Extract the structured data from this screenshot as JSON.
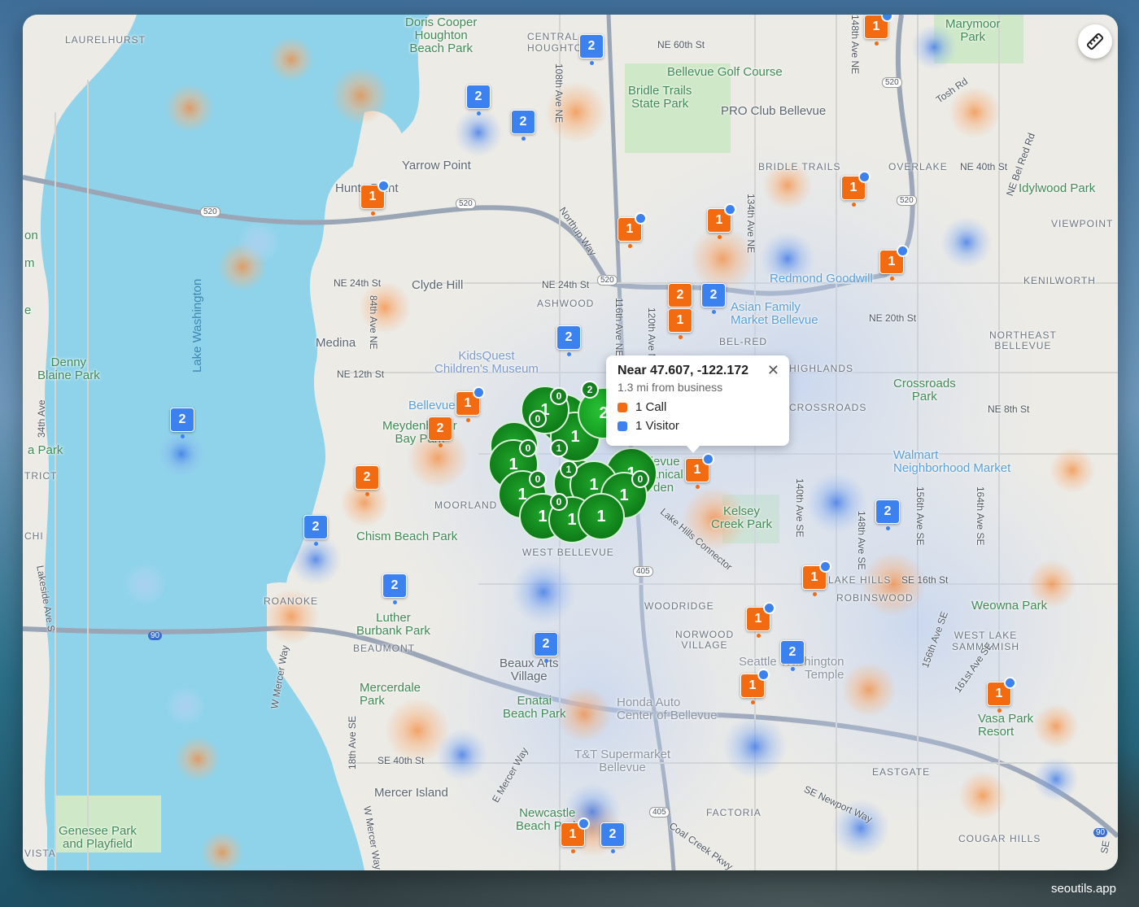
{
  "tooltip": {
    "title": "Near 47.607, -122.172",
    "subtitle": "1.3 mi from business",
    "legend": [
      {
        "label": "1 Call",
        "color": "#f26b10"
      },
      {
        "label": "1 Visitor",
        "color": "#3b82f0"
      }
    ]
  },
  "colors": {
    "call": "#f26b10",
    "visitor": "#3b82f0",
    "cluster": "#12861d",
    "water": "#8fd3ea"
  },
  "watermark": "seoutils.app",
  "toolbar": {
    "ruler_icon": "ruler-icon"
  },
  "places": {
    "laurelhurst": "LAURELHURST",
    "doris_cooper": "Doris Cooper\nHoughton\nBeach Park",
    "central_houghton": "CENTRAL\nHOUGHTON",
    "marymoor": "Marymoor\nPark",
    "yarrow_point": "Yarrow Point",
    "hunts_point": "Hunts Point",
    "clyde_hill": "Clyde Hill",
    "medina": "Medina",
    "denny_blaine": "Denny\nBlaine Park",
    "lake_washington": "Lake Washington",
    "bellevue_golf": "Bellevue Golf Course",
    "bridle_trails_park": "Bridle Trails\nState Park",
    "pro_club": "PRO Club Bellevue",
    "bridle_trails": "BRIDLE TRAILS",
    "overlake": "OVERLAKE",
    "idylwood": "Idylwood Park",
    "viewpoint": "VIEWPOINT",
    "kenilworth": "KENILWORTH",
    "redmond_goodwill": "Redmond Goodwill",
    "asian_family": "Asian Family\nMarket Bellevue",
    "ashwood": "ASHWOOD",
    "bel_red": "BEL-RED",
    "highlands": "HIGHLANDS",
    "northeast_bellevue": "NORTHEAST\nBELLEVUE",
    "crossroads_park": "Crossroads\nPark",
    "crossroads": "CROSSROADS",
    "kidsquest": "KidsQuest\nChildren's Museum",
    "bellevue": "Bellevue",
    "meydenbauer": "Meydenbauer\nBay Park",
    "moorland": "MOORLAND",
    "bellevue_botanical": "Bellevue\nBotanical\nGarden",
    "walmart": "Walmart\nNeighborhood Market",
    "kelsey_creek": "Kelsey\nCreek Park",
    "chism_beach": "Chism Beach Park",
    "west_bellevue": "WEST BELLEVUE",
    "lake_hills": "LAKE HILLS",
    "robinswood": "ROBINSWOOD",
    "weowna": "Weowna Park",
    "west_lake_sammamish": "WEST LAKE\nSAMMAMISH",
    "roanoke": "ROANOKE",
    "luther_burbank": "Luther\nBurbank Park",
    "beaumont": "BEAUMONT",
    "woodridge": "WOODRIDGE",
    "norwood": "NORWOOD\nVILLAGE",
    "beaux_arts": "Beaux Arts\nVillage",
    "enatai": "Enatai\nBeach Park",
    "mercerdale": "Mercerdale\nPark",
    "seattle_temple": "Seattle Washington\nTemple",
    "honda": "Honda Auto\nCenter of Bellevue",
    "vasa_park": "Vasa Park\nResort",
    "tt_supermarket": "T&T Supermarket\nBellevue",
    "eastgate": "EASTGATE",
    "mercer_island": "Mercer Island",
    "factoria": "FACTORIA",
    "newcastle_beach": "Newcastle\nBeach Park",
    "cougar_hills": "COUGAR HILLS",
    "genesee": "Genesee Park\nand Playfield",
    "vista": "VISTA",
    "chi": "CHI",
    "trict": "TRICT",
    "a_park": "a Park",
    "on": "on",
    "m": "m",
    "e": "e"
  },
  "streets": {
    "ne60": "NE 60th St",
    "ne24_w": "NE 24th St",
    "ne24_e": "NE 24th St",
    "ne12": "NE 12th St",
    "ne20": "NE 20th St",
    "ne40": "NE 40th St",
    "ne8": "NE 8th St",
    "se16": "SE 16th St",
    "se40": "SE 40th St",
    "ave84": "84th Ave NE",
    "ave108": "108th Ave NE",
    "ave116": "116th Ave NE",
    "ave120": "120th Ave NE",
    "ave134": "134th Ave NE",
    "ave140": "140th Ave SE",
    "ave148": "148th Ave SE",
    "ave156": "156th Ave SE",
    "ave164": "164th Ave SE",
    "ave156b": "156th Ave SE",
    "ave161": "161st Ave SE",
    "ave34": "34th Ave",
    "lakeside": "Lakeside Ave S",
    "w_mercer": "W Mercer Way",
    "w_mercer2": "W Mercer Way",
    "e_mercer": "E Mercer Way",
    "ave18": "18th Ave SE",
    "northup": "Northup Way",
    "tosh": "Tosh Rd",
    "bel_red_rd": "NE Bel Red Rd",
    "lake_hills_conn": "Lake Hills Connector",
    "se_newport": "SE Newport Way",
    "coal_creek": "Coal Creek Pkwy",
    "ave148n": "148th Ave NE",
    "hwy520a": "520",
    "hwy520b": "520",
    "hwy520c": "520",
    "hwy520d": "520",
    "hwy520e": "520",
    "hwy405": "405",
    "hwy405b": "405",
    "hwy90a": "90",
    "hwy90b": "90",
    "se": "SE"
  },
  "markers": [
    {
      "type": "call",
      "count": "1",
      "dot": true
    },
    {
      "type": "visitor",
      "count": "2",
      "dot": false
    },
    {
      "type": "visitor",
      "count": "2",
      "dot": false
    },
    {
      "type": "visitor",
      "count": "2",
      "dot": false
    },
    {
      "type": "call",
      "count": "1",
      "dot": true
    },
    {
      "type": "call",
      "count": "1",
      "dot": true
    },
    {
      "type": "call",
      "count": "1",
      "dot": true
    },
    {
      "type": "call",
      "count": "1",
      "dot": true
    },
    {
      "type": "call",
      "count": "1",
      "dot": true
    },
    {
      "type": "call",
      "count": "2",
      "dot": false
    },
    {
      "type": "visitor",
      "count": "2",
      "dot": false
    },
    {
      "type": "call",
      "count": "1",
      "dot": false
    },
    {
      "type": "visitor",
      "count": "2",
      "dot": false
    },
    {
      "type": "call",
      "count": "1",
      "dot": true
    },
    {
      "type": "call",
      "count": "2",
      "dot": false
    },
    {
      "type": "visitor",
      "count": "2",
      "dot": false
    },
    {
      "type": "call",
      "count": "2",
      "dot": false
    },
    {
      "type": "call",
      "count": "1",
      "dot": true
    },
    {
      "type": "visitor",
      "count": "2",
      "dot": false
    },
    {
      "type": "visitor",
      "count": "2",
      "dot": false
    },
    {
      "type": "visitor",
      "count": "2",
      "dot": false
    },
    {
      "type": "call",
      "count": "1",
      "dot": true
    },
    {
      "type": "call",
      "count": "1",
      "dot": true
    },
    {
      "type": "visitor",
      "count": "2",
      "dot": false
    },
    {
      "type": "visitor",
      "count": "2",
      "dot": false
    },
    {
      "type": "call",
      "count": "1",
      "dot": true
    },
    {
      "type": "call",
      "count": "1",
      "dot": true
    },
    {
      "type": "call",
      "count": "1",
      "dot": true
    },
    {
      "type": "visitor",
      "count": "2",
      "dot": false
    },
    {
      "type": "call",
      "count": "1",
      "dot": false
    }
  ],
  "cluster": [
    {
      "label": "1"
    },
    {
      "label": "1"
    },
    {
      "label": "2"
    },
    {
      "label": "1"
    },
    {
      "label": "1"
    },
    {
      "label": "1"
    },
    {
      "label": "1"
    },
    {
      "label": "1"
    },
    {
      "label": "1"
    },
    {
      "label": "1"
    },
    {
      "label": "1"
    },
    {
      "label": "1"
    },
    {
      "label": "1"
    }
  ],
  "cluster_badges": [
    "0",
    "2",
    "0",
    "0",
    "0",
    "0",
    "0",
    "0",
    "1",
    "1"
  ]
}
